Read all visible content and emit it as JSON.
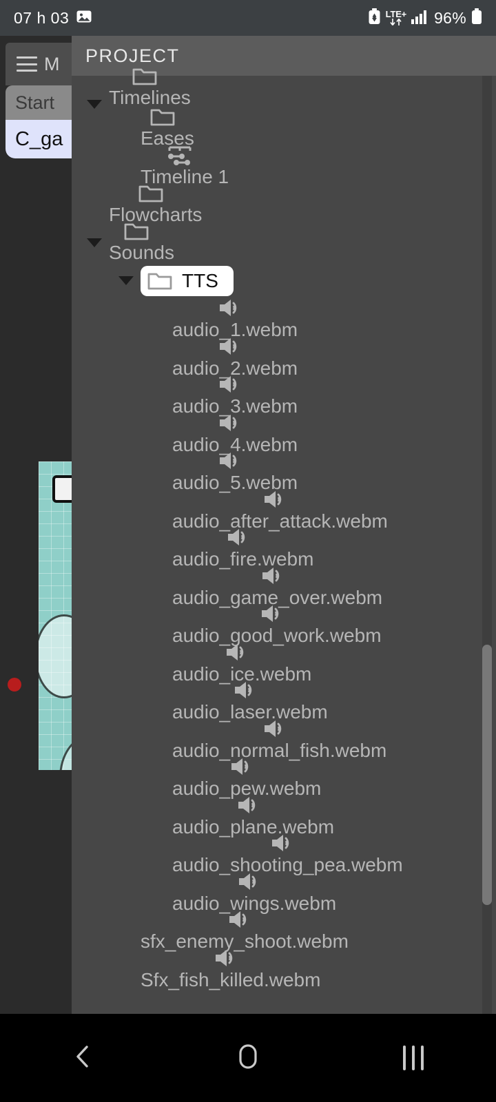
{
  "status_bar": {
    "clock": "07 h 03",
    "screenshot_icon": "image-icon",
    "battery_saver_icon": "battery-saver-icon",
    "network_label": "LTE+",
    "data_arrows_icon": "data-transfer-icon",
    "signal_icon": "signal-bars-icon",
    "battery_percent": "96%",
    "battery_icon": "battery-full-icon"
  },
  "left_column": {
    "menu_icon": "hamburger-menu-icon",
    "menu_label": "M",
    "tab_start": "Start",
    "tab_selected": "C_ga",
    "canvas": {
      "note_icon": "sticky-note-icon",
      "record_dot": "record-dot"
    }
  },
  "panel": {
    "title": "PROJECT",
    "tree": [
      {
        "label": "Timelines",
        "icon": "folder-open-icon",
        "indent": 1,
        "caret": "down",
        "selected": false,
        "partial_top": true
      },
      {
        "label": "Eases",
        "icon": "folder-icon",
        "indent": 2,
        "caret": "none",
        "selected": false
      },
      {
        "label": "Timeline 1",
        "icon": "timeline-icon",
        "indent": 2,
        "caret": "none",
        "selected": false
      },
      {
        "label": "Flowcharts",
        "icon": "folder-icon",
        "indent": 1,
        "caret": "none",
        "selected": false
      },
      {
        "label": "Sounds",
        "icon": "folder-icon",
        "indent": 1,
        "caret": "down",
        "selected": false
      },
      {
        "label": "TTS",
        "icon": "folder-icon",
        "indent": 2,
        "caret": "down",
        "selected": true
      },
      {
        "label": "audio_1.webm",
        "icon": "speaker-icon",
        "indent": 3,
        "caret": "none",
        "selected": false
      },
      {
        "label": "audio_2.webm",
        "icon": "speaker-icon",
        "indent": 3,
        "caret": "none",
        "selected": false
      },
      {
        "label": "audio_3.webm",
        "icon": "speaker-icon",
        "indent": 3,
        "caret": "none",
        "selected": false
      },
      {
        "label": "audio_4.webm",
        "icon": "speaker-icon",
        "indent": 3,
        "caret": "none",
        "selected": false
      },
      {
        "label": "audio_5.webm",
        "icon": "speaker-icon",
        "indent": 3,
        "caret": "none",
        "selected": false
      },
      {
        "label": "audio_after_attack.webm",
        "icon": "speaker-icon",
        "indent": 3,
        "caret": "none",
        "selected": false
      },
      {
        "label": "audio_fire.webm",
        "icon": "speaker-icon",
        "indent": 3,
        "caret": "none",
        "selected": false
      },
      {
        "label": "audio_game_over.webm",
        "icon": "speaker-icon",
        "indent": 3,
        "caret": "none",
        "selected": false
      },
      {
        "label": "audio_good_work.webm",
        "icon": "speaker-icon",
        "indent": 3,
        "caret": "none",
        "selected": false
      },
      {
        "label": "audio_ice.webm",
        "icon": "speaker-icon",
        "indent": 3,
        "caret": "none",
        "selected": false
      },
      {
        "label": "audio_laser.webm",
        "icon": "speaker-icon",
        "indent": 3,
        "caret": "none",
        "selected": false
      },
      {
        "label": "audio_normal_fish.webm",
        "icon": "speaker-icon",
        "indent": 3,
        "caret": "none",
        "selected": false
      },
      {
        "label": "audio_pew.webm",
        "icon": "speaker-icon",
        "indent": 3,
        "caret": "none",
        "selected": false
      },
      {
        "label": "audio_plane.webm",
        "icon": "speaker-icon",
        "indent": 3,
        "caret": "none",
        "selected": false
      },
      {
        "label": "audio_shooting_pea.webm",
        "icon": "speaker-icon",
        "indent": 3,
        "caret": "none",
        "selected": false
      },
      {
        "label": "audio_wings.webm",
        "icon": "speaker-icon",
        "indent": 3,
        "caret": "none",
        "selected": false
      },
      {
        "label": "sfx_enemy_shoot.webm",
        "icon": "speaker-icon",
        "indent": 2,
        "caret": "none",
        "selected": false
      },
      {
        "label": "Sfx_fish_killed.webm",
        "icon": "speaker-icon",
        "indent": 2,
        "caret": "none",
        "selected": false
      }
    ]
  },
  "scrollbars": {
    "vertical_thumb_top_pct": 59,
    "vertical_thumb_height_pct": 27,
    "horizontal_thumb_left_pct": 1,
    "horizontal_thumb_width_pct": 93
  },
  "nav_bar": {
    "back": "back-icon",
    "home": "home-icon",
    "recents": "recents-icon"
  },
  "colors": {
    "panel_bg": "#474747",
    "panel_header_bg": "#5c5c5c",
    "app_bg": "#2b2b2b",
    "status_bg": "#3c4043",
    "text": "#b6b6b6",
    "selected_bg": "#ffffff",
    "selected_text": "#111111",
    "tab_selected_bg": "#dfe3fb",
    "canvas_grid": "#8fcfc8",
    "record_dot": "#b81d1d"
  }
}
